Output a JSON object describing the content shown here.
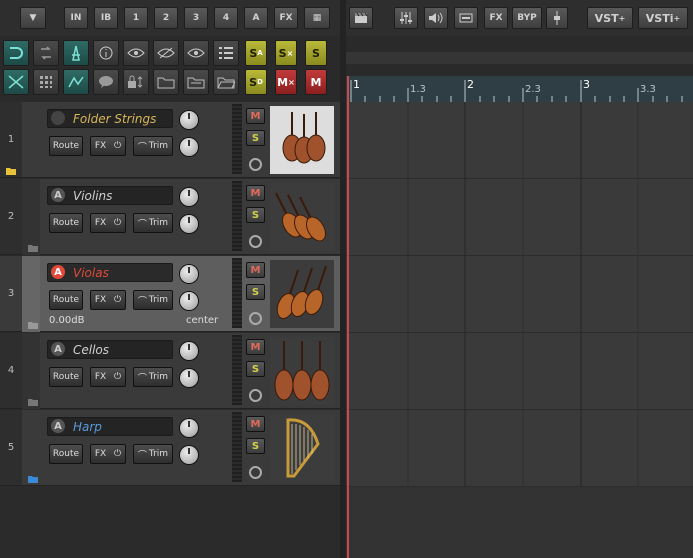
{
  "toolbar": {
    "menu_arrow": "▼",
    "tab_in": "IN",
    "tab_ib": "IB",
    "tab_1": "1",
    "tab_2": "2",
    "tab_3": "3",
    "tab_4": "4",
    "tab_a": "A",
    "tab_fx": "FX",
    "tab_piano": "▦",
    "right_fx": "FX",
    "right_byp": "BYP",
    "vst": "VST",
    "vsti": "VSTi"
  },
  "tcp_buttons": {
    "s_a": "S",
    "s_a_sup": "A",
    "s_x": "S",
    "s_plain": "S",
    "s_d": "S",
    "s_d_sup": "D",
    "m_x": "M",
    "m_plain": "M"
  },
  "ruler": {
    "markers": [
      "1",
      "1.3",
      "2",
      "2.3",
      "3",
      "3.3"
    ]
  },
  "tracks": [
    {
      "number": "1",
      "name": "Folder Strings",
      "route": "Route",
      "fx": "FX",
      "trim": "Trim",
      "mute": "M",
      "solo": "S",
      "rec_label": ""
    },
    {
      "number": "2",
      "name": "Violins",
      "route": "Route",
      "fx": "FX",
      "trim": "Trim",
      "mute": "M",
      "solo": "S",
      "rec_label": "A"
    },
    {
      "number": "3",
      "name": "Violas",
      "route": "Route",
      "fx": "FX",
      "trim": "Trim",
      "mute": "M",
      "solo": "S",
      "rec_label": "A",
      "volume": "0.00dB",
      "pan": "center"
    },
    {
      "number": "4",
      "name": "Cellos",
      "route": "Route",
      "fx": "FX",
      "trim": "Trim",
      "mute": "M",
      "solo": "S",
      "rec_label": "A"
    },
    {
      "number": "5",
      "name": "Harp",
      "route": "Route",
      "fx": "FX",
      "trim": "Trim",
      "mute": "M",
      "solo": "S",
      "rec_label": "A"
    }
  ],
  "colors": {
    "folder_name": "#d9b65a",
    "violas_name": "#e04a3a",
    "harp_name": "#5a9ad8",
    "default_name": "#cfcfcf",
    "accent_teal": "#2f6b66"
  }
}
